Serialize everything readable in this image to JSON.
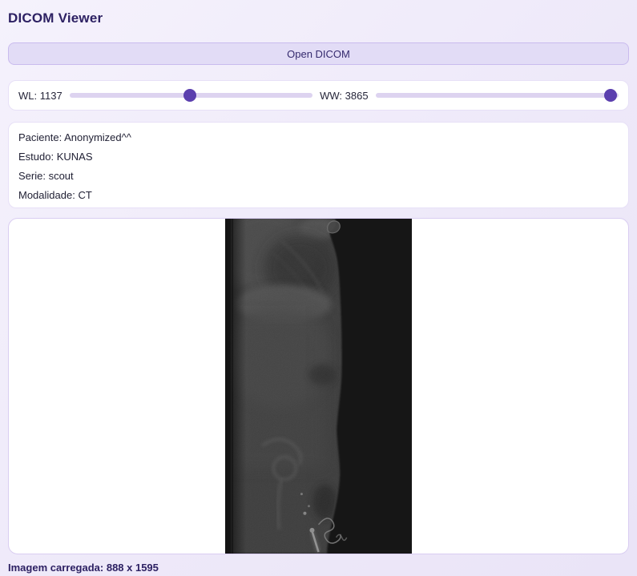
{
  "page": {
    "title": "DICOM Viewer"
  },
  "toolbar": {
    "open_button_label": "Open DICOM"
  },
  "sliders": {
    "wl": {
      "label": "WL: 1137",
      "value": 1137,
      "percent": 49.7
    },
    "ww": {
      "label": "WW: 3865",
      "value": 3865,
      "percent": 96.7
    }
  },
  "patient_info": {
    "lines": [
      "Paciente: Anonymized^^",
      "Estudo: KUNAS",
      "Serie: scout",
      "Modalidade: CT"
    ]
  },
  "viewer": {
    "image_name": "ct-scout-lateral-image"
  },
  "status": {
    "text": "Imagem carregada: 888 x 1595"
  },
  "colors": {
    "accent": "#5b3fae",
    "title": "#2d2163",
    "button_bg": "#e2dcf6",
    "track": "#ddd3f0",
    "panel_border": "#d9cdf1",
    "image_bg": "#161616"
  }
}
